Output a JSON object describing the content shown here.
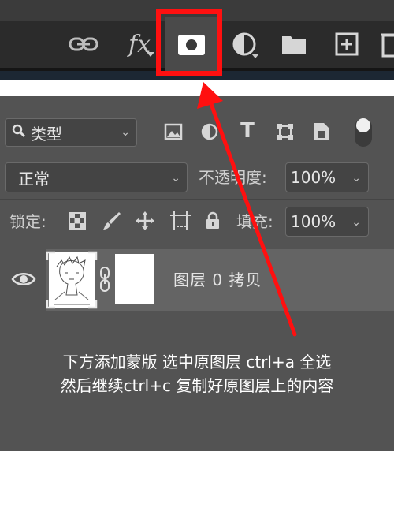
{
  "colors": {
    "annotation": "#ff1010",
    "panel": "#535353",
    "toolbar": "#2b2b2b",
    "selected_row": "#646464"
  },
  "toolbar": {
    "icons": [
      "link-icon",
      "fx-icon",
      "add-mask-icon",
      "adjustment-layer-icon",
      "folder-icon",
      "new-layer-icon",
      "trash-icon"
    ],
    "fx_label": "fx"
  },
  "filter": {
    "kind_label": "类型",
    "icons": [
      "image-filter-icon",
      "adjustment-filter-icon",
      "type-filter-icon",
      "shape-filter-icon",
      "smart-object-filter-icon"
    ]
  },
  "blend": {
    "mode": "正常",
    "opacity_label": "不透明度:",
    "opacity_value": "100%"
  },
  "lock": {
    "label": "锁定:",
    "fill_label": "填充:",
    "fill_value": "100%"
  },
  "layer": {
    "name": "图层 0 拷贝"
  },
  "caption": {
    "line1": "下方添加蒙版 选中原图层 ctrl+a 全选",
    "line2": "然后继续ctrl+c 复制好原图层上的内容"
  }
}
